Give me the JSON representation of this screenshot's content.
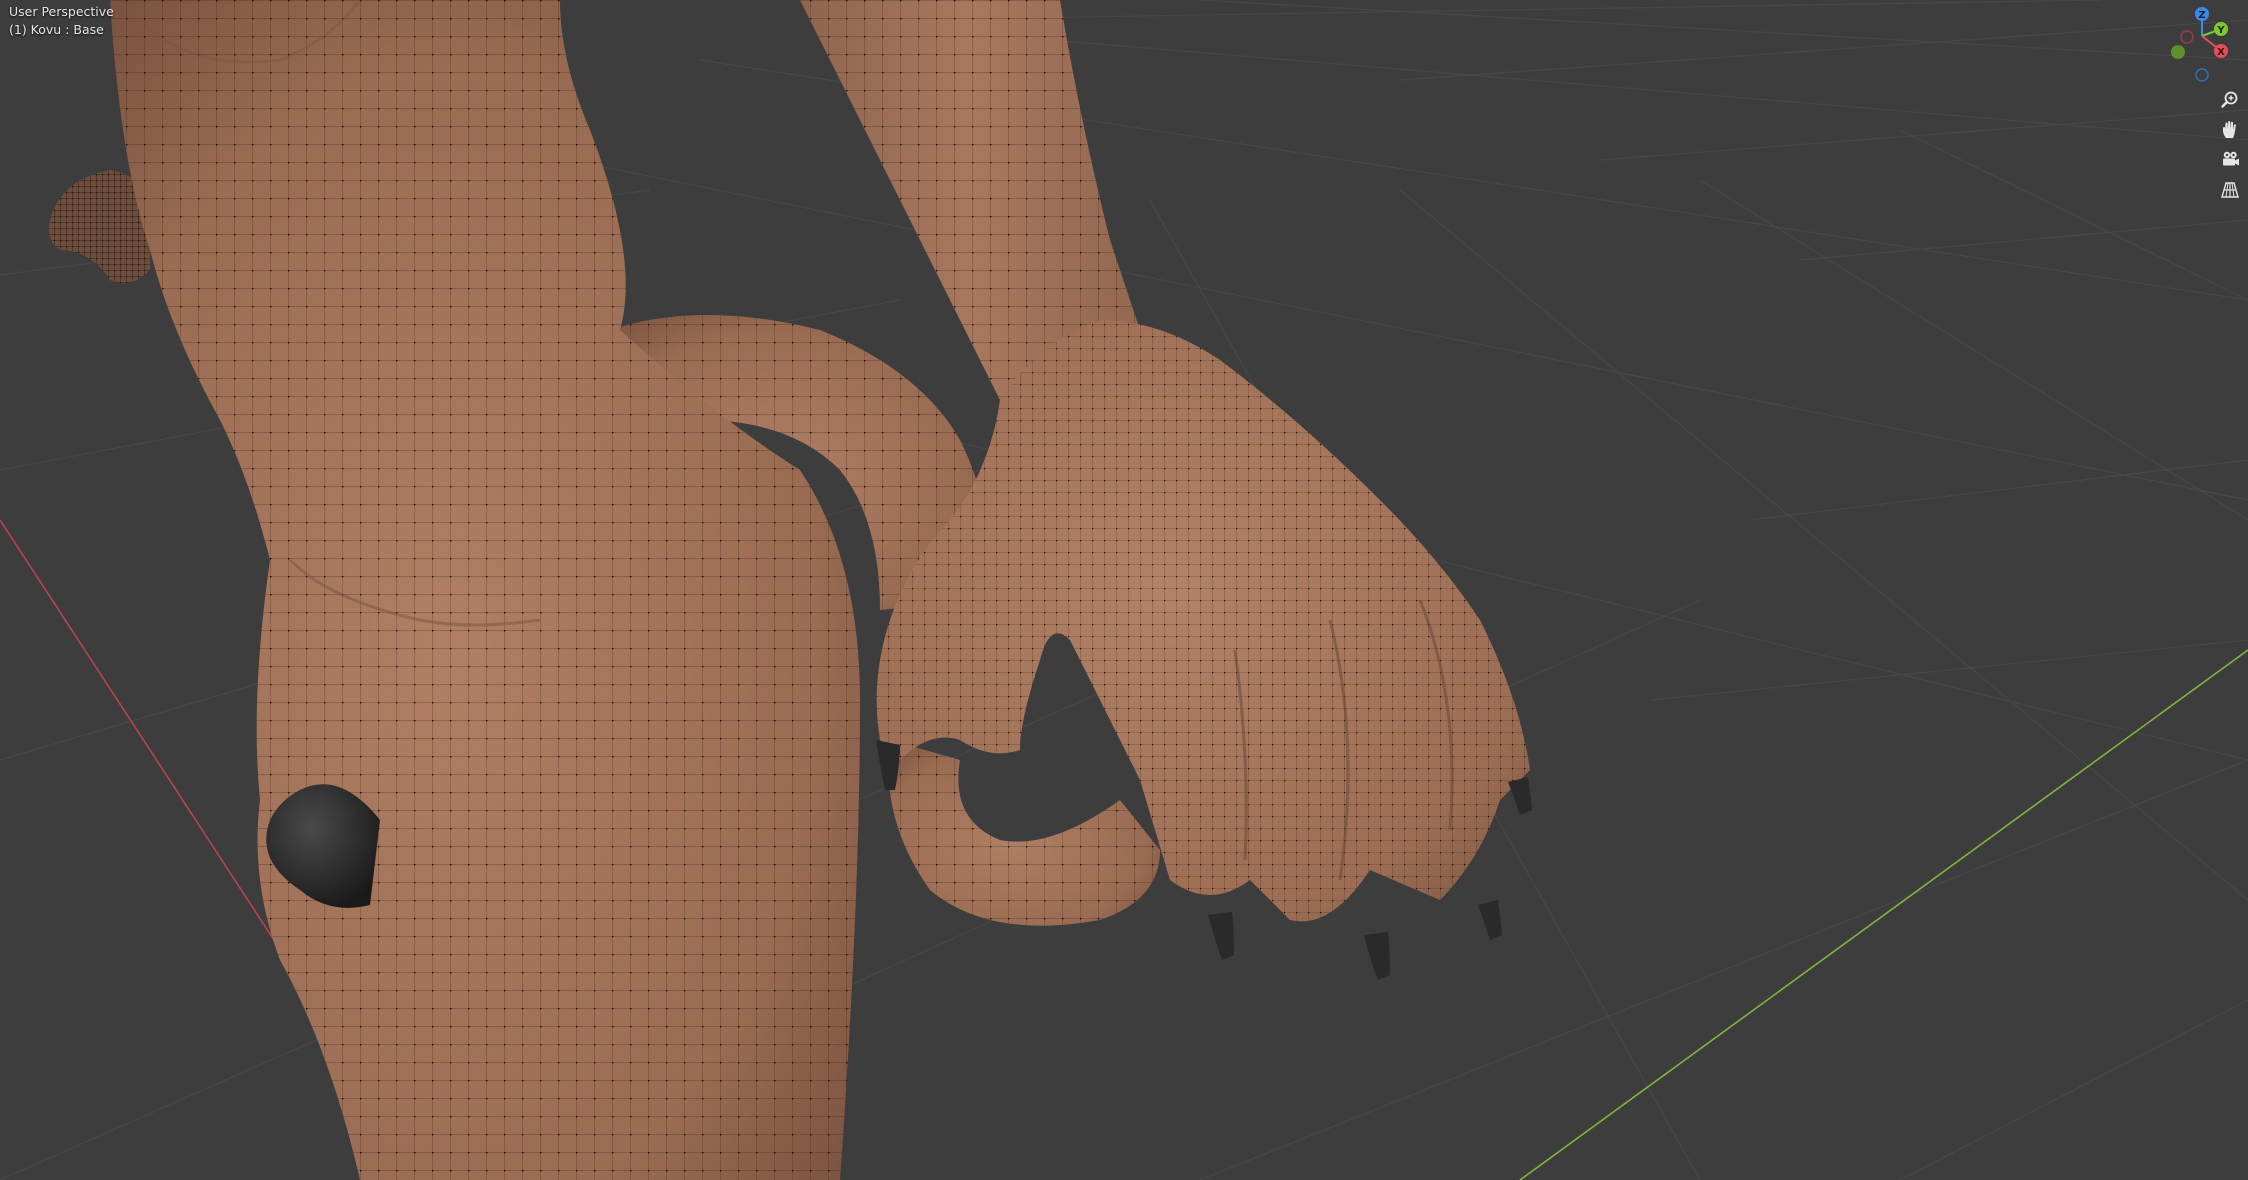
{
  "viewport": {
    "view_name": "User Perspective",
    "object_info": "(1) Kovu : Base",
    "background_color": "#3d3d3d",
    "grid_color": "#474747",
    "mesh_color": "#a0735a",
    "x_axis_color": "#b8434f",
    "y_axis_color": "#7fb53b"
  },
  "gizmo": {
    "x_label": "X",
    "y_label": "Y",
    "z_label": "Z",
    "x_color": "#e44d5b",
    "y_color": "#7ec730",
    "z_color": "#3b8be6"
  },
  "navigation": [
    {
      "name": "zoom-icon",
      "tooltip": "Zoom"
    },
    {
      "name": "pan-hand-icon",
      "tooltip": "Move"
    },
    {
      "name": "camera-icon",
      "tooltip": "Toggle camera view"
    },
    {
      "name": "grid-perspective-icon",
      "tooltip": "Toggle perspective/orthographic"
    }
  ]
}
